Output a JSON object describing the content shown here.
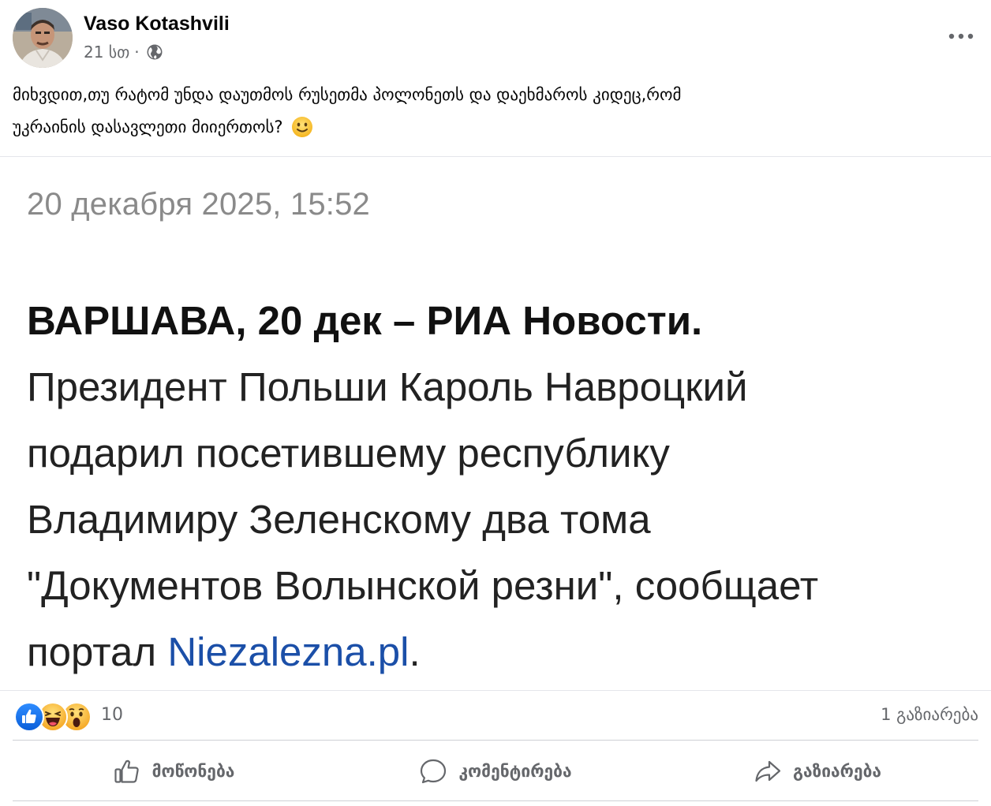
{
  "post": {
    "author": "Vaso Kotashvili",
    "time": "21 სთ",
    "separator": "·",
    "privacy_icon": "globe-icon",
    "more_icon": "more-horizontal-icon",
    "text_line1": "მიხვდით,თუ რატომ უნდა დაუთმოს რუსეთმა პოლონეთს და დაეხმაროს კიდეც,რომ",
    "text_line2": "უკრაინის  დასავლეთი  მიიერთოს?",
    "text_emoji": "slightly-smiling-face-emoji"
  },
  "news_image": {
    "date": "20 декабря 2025, 15:52",
    "dateline": "ВАРШАВА, 20 дек – РИА Новости.",
    "line1": "Президент Польши Кароль Навроцкий",
    "line2": "подарил посетившему республику",
    "line3": "Владимиру Зеленскому два тома",
    "line4": "\"Документов Волынской резни\", сообщает",
    "line5_prefix": "портал ",
    "line5_link": "Niezalezna.pl",
    "line5_suffix": "."
  },
  "reactions": {
    "icons": [
      "like-reaction-icon",
      "haha-reaction-icon",
      "wow-reaction-icon"
    ],
    "count": "10",
    "shares": "1 გაზიარება"
  },
  "actions": {
    "like_label": "მოწონება",
    "comment_label": "კომენტირება",
    "share_label": "გაზიარება"
  },
  "colors": {
    "secondary_text": "#65676b",
    "link_blue": "#1b4fa8",
    "like_blue": "#1877f2",
    "reaction_yellow": "#f7b125"
  }
}
